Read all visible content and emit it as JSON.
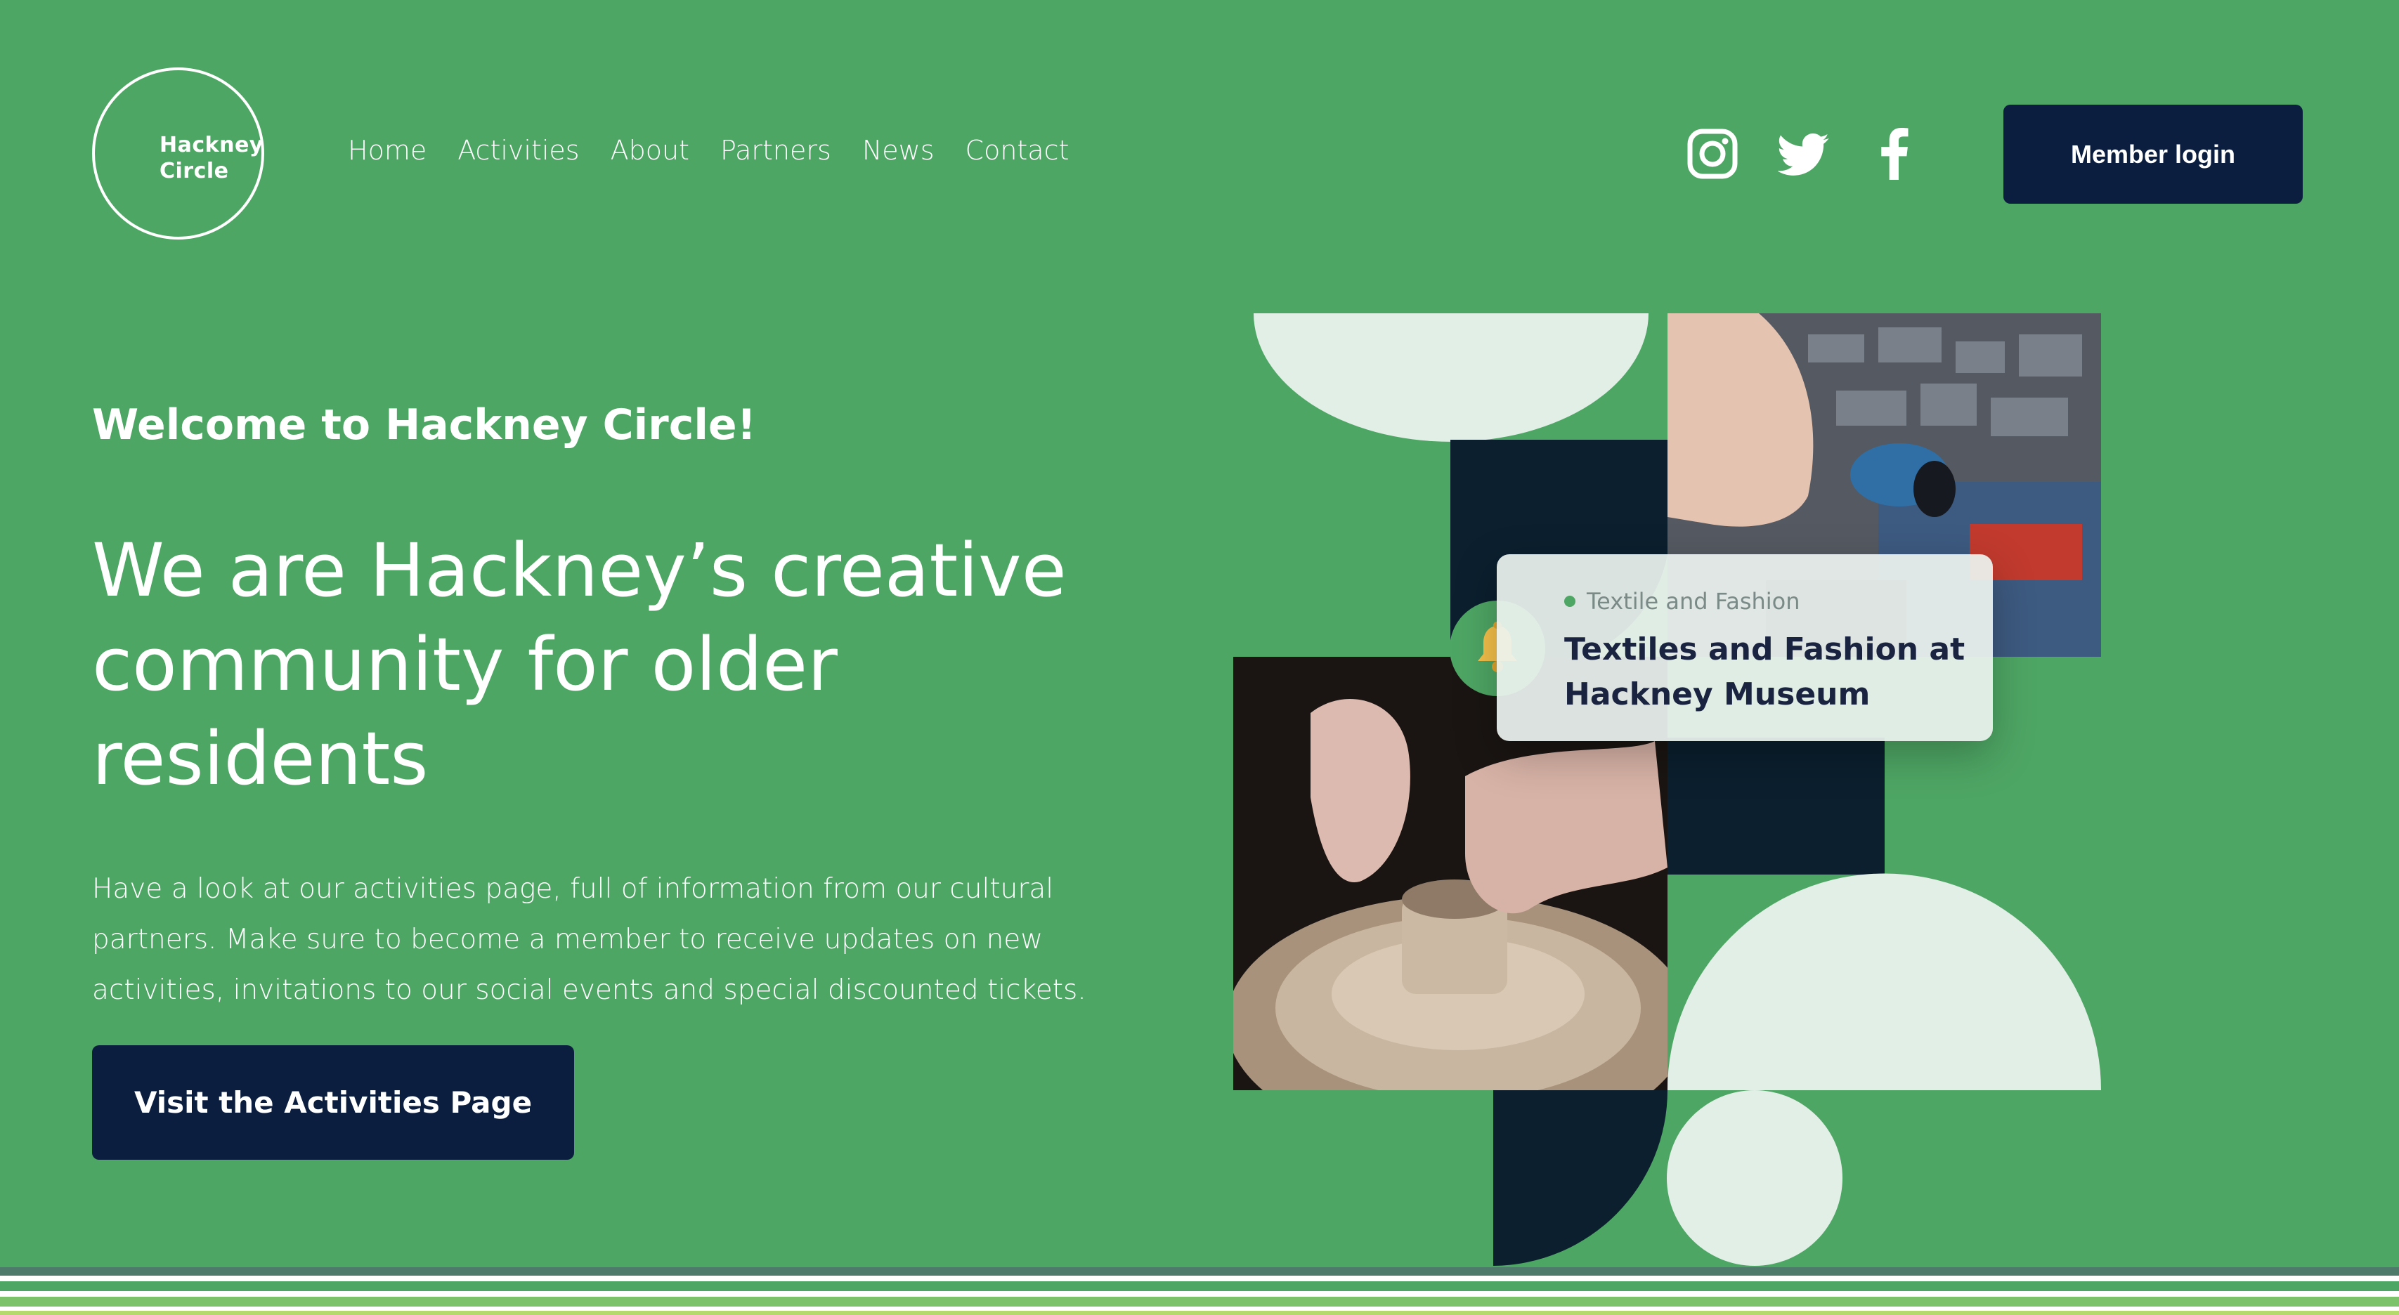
{
  "header": {
    "logo_text": "Hackney\nCircle",
    "nav": [
      "Home",
      "Activities",
      "About",
      "Partners",
      "News",
      "Contact"
    ],
    "social": [
      "instagram-icon",
      "twitter-icon",
      "facebook-icon"
    ],
    "login_label": "Member login"
  },
  "hero": {
    "welcome": "Welcome to Hackney Circle!",
    "headline": "We are Hackney’s creative community for older residents",
    "description": "Have a look at our activities page, full of information from our cultural partners. Make sure to become a member to receive updates on new activities, invitations to our social events and special discounted tickets.",
    "cta_label": "Visit the Activities Page"
  },
  "event_card": {
    "tag": "Textile and Fashion",
    "title": "Textiles and Fashion at Hackney Museum",
    "icon": "bell-icon"
  },
  "colors": {
    "background": "#4ea664",
    "navy": "#0c1e3f",
    "dark_shape": "#0b1f2e",
    "pale_shape": "#e2efe7"
  }
}
